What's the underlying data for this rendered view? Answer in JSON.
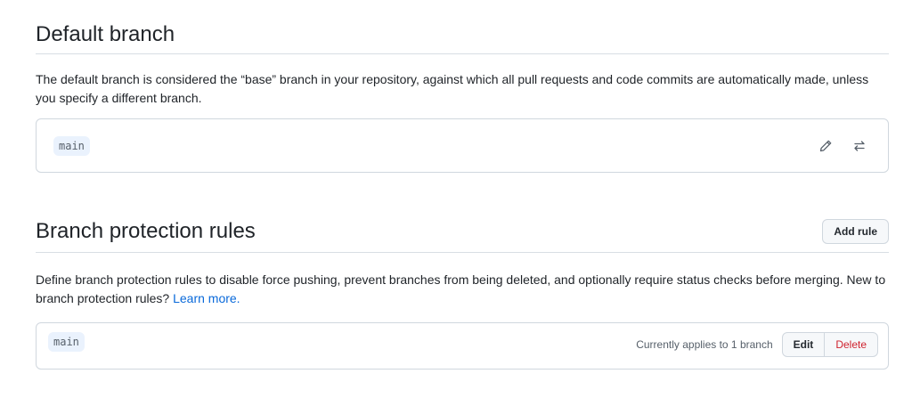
{
  "default_branch": {
    "title": "Default branch",
    "description": "The default branch is considered the “base” branch in your repository, against which all pull requests and code commits are automatically made, unless you specify a different branch.",
    "branch_name": "main",
    "icons": [
      "pencil-icon",
      "arrow-switch-icon"
    ]
  },
  "protection": {
    "title": "Branch protection rules",
    "add_rule_label": "Add rule",
    "description_text": "Define branch protection rules to disable force pushing, prevent branches from being deleted, and optionally require status checks before merging. New to branch protection rules?",
    "learn_more_label": "Learn more.",
    "rules": [
      {
        "branch": "main",
        "applies_text": "Currently applies to 1 branch",
        "edit_label": "Edit",
        "delete_label": "Delete"
      }
    ]
  },
  "colors": {
    "link": "#0969da",
    "danger": "#cf222e",
    "border": "#d0d7de",
    "tag_bg": "#eaf2fd"
  }
}
